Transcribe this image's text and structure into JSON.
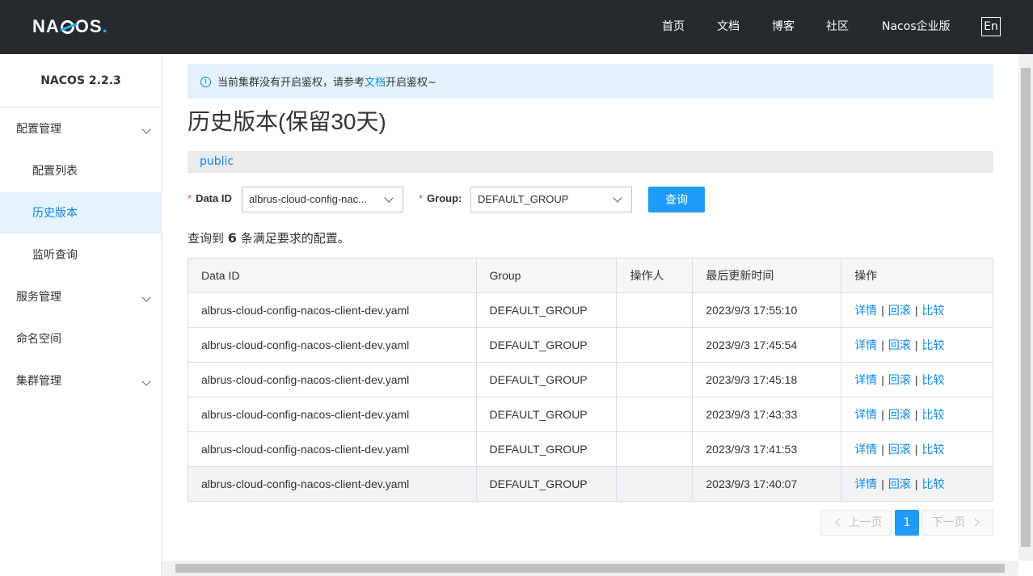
{
  "header": {
    "logo_text": "NACOS",
    "nav": [
      "首页",
      "文档",
      "博客",
      "社区",
      "Nacos企业版"
    ],
    "lang": "En"
  },
  "sidebar": {
    "version": "NACOS 2.2.3",
    "items": [
      {
        "label": "配置管理"
      },
      {
        "label": "配置列表"
      },
      {
        "label": "历史版本"
      },
      {
        "label": "监听查询"
      },
      {
        "label": "服务管理"
      },
      {
        "label": "命名空间"
      },
      {
        "label": "集群管理"
      }
    ]
  },
  "notice": {
    "before": "当前集群没有开启鉴权，请参考",
    "link": "文档",
    "after": "开启鉴权~"
  },
  "page_title": "历史版本(保留30天)",
  "namespace": "public",
  "filters": {
    "data_id_label": "Data ID",
    "data_id_value": "albrus-cloud-config-nac...",
    "group_label": "Group:",
    "group_value": "DEFAULT_GROUP",
    "query_button": "查询"
  },
  "result": {
    "prefix": "查询到",
    "count": "6",
    "suffix": "条满足要求的配置。"
  },
  "table": {
    "headers": [
      "Data ID",
      "Group",
      "操作人",
      "最后更新时间",
      "操作"
    ],
    "rows": [
      {
        "data_id": "albrus-cloud-config-nacos-client-dev.yaml",
        "group": "DEFAULT_GROUP",
        "operator": "",
        "time": "2023/9/3 17:55:10"
      },
      {
        "data_id": "albrus-cloud-config-nacos-client-dev.yaml",
        "group": "DEFAULT_GROUP",
        "operator": "",
        "time": "2023/9/3 17:45:54"
      },
      {
        "data_id": "albrus-cloud-config-nacos-client-dev.yaml",
        "group": "DEFAULT_GROUP",
        "operator": "",
        "time": "2023/9/3 17:45:18"
      },
      {
        "data_id": "albrus-cloud-config-nacos-client-dev.yaml",
        "group": "DEFAULT_GROUP",
        "operator": "",
        "time": "2023/9/3 17:43:33"
      },
      {
        "data_id": "albrus-cloud-config-nacos-client-dev.yaml",
        "group": "DEFAULT_GROUP",
        "operator": "",
        "time": "2023/9/3 17:41:53"
      },
      {
        "data_id": "albrus-cloud-config-nacos-client-dev.yaml",
        "group": "DEFAULT_GROUP",
        "operator": "",
        "time": "2023/9/3 17:40:07"
      }
    ],
    "actions": {
      "detail": "详情",
      "rollback": "回滚",
      "compare": "比较",
      "separator": "|"
    }
  },
  "pagination": {
    "prev": "上一页",
    "current": "1",
    "next": "下一页"
  },
  "colors": {
    "header_bg": "#252a2f",
    "accent": "#209bfa",
    "link": "#1187e7",
    "active_bg": "#e5f3ff"
  }
}
